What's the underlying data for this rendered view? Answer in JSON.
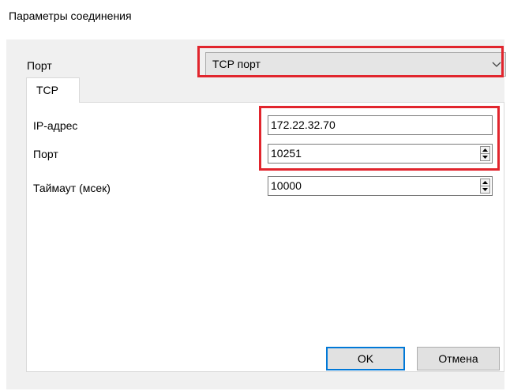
{
  "dialog": {
    "title": "Параметры соединения"
  },
  "port": {
    "label": "Порт",
    "selected": "TCP порт"
  },
  "tabs": [
    {
      "label": "TCP"
    }
  ],
  "fields": {
    "ip": {
      "label": "IP-адрес",
      "value": "172.22.32.70"
    },
    "port": {
      "label": "Порт",
      "value": "10251"
    },
    "timeout": {
      "label": "Таймаут (мсек)",
      "value": "10000"
    }
  },
  "buttons": {
    "ok": "OK",
    "cancel": "Отмена"
  },
  "colors": {
    "highlight": "#e1252d",
    "focus": "#0078d7",
    "panel": "#f0f0f0"
  },
  "icons": {
    "dropdown": "chevron-down-icon",
    "spinner": "spin-arrows-icon"
  }
}
